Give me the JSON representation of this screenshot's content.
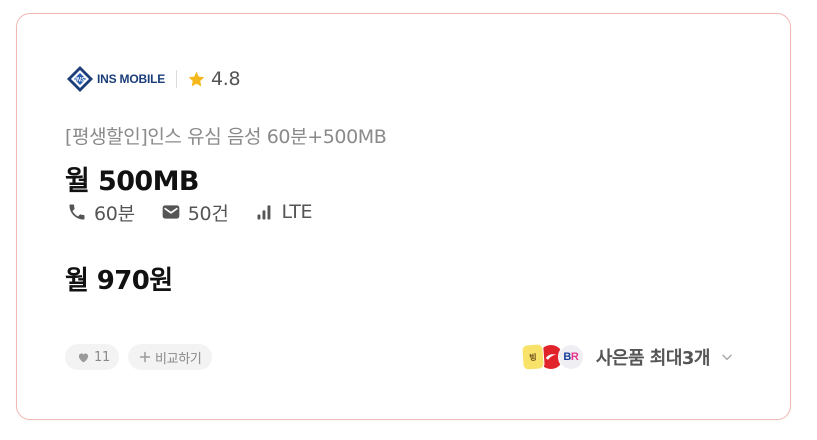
{
  "card": {
    "provider": {
      "logo_text_ins": "INS",
      "logo_text_mobile": "MOBILE",
      "rating": "4.8",
      "icons": {
        "logo": "ins-mobile-logo",
        "rating": "star-icon"
      },
      "colors": {
        "logo": "#1b3e7a",
        "star": "#f5b81c"
      }
    },
    "plan_name": "[평생할인]인스 유심 음성 60분+500MB",
    "data_amount": "월 500MB",
    "specs": {
      "voice": "60분",
      "sms": "50건",
      "network": "LTE",
      "icons": {
        "voice": "phone-icon",
        "sms": "message-icon",
        "network": "signal-icon"
      }
    },
    "price": "월 970원",
    "actions": {
      "like_count": "11",
      "compare_label": "비교하기",
      "icons": {
        "like": "heart-icon",
        "compare": "plus-icon"
      }
    },
    "gift": {
      "label": "사은품 최대3개",
      "brands": [
        {
          "name": "banana-milk-badge",
          "text": "빙그레",
          "color": "#f8e26a"
        },
        {
          "name": "coke-badge",
          "text": "",
          "color": "#e0242a"
        },
        {
          "name": "baskin-robbins-badge",
          "text": "BR",
          "color": "#e8338d"
        }
      ],
      "icon": "chevron-down-icon"
    },
    "border_color": "#f0b8b4"
  }
}
